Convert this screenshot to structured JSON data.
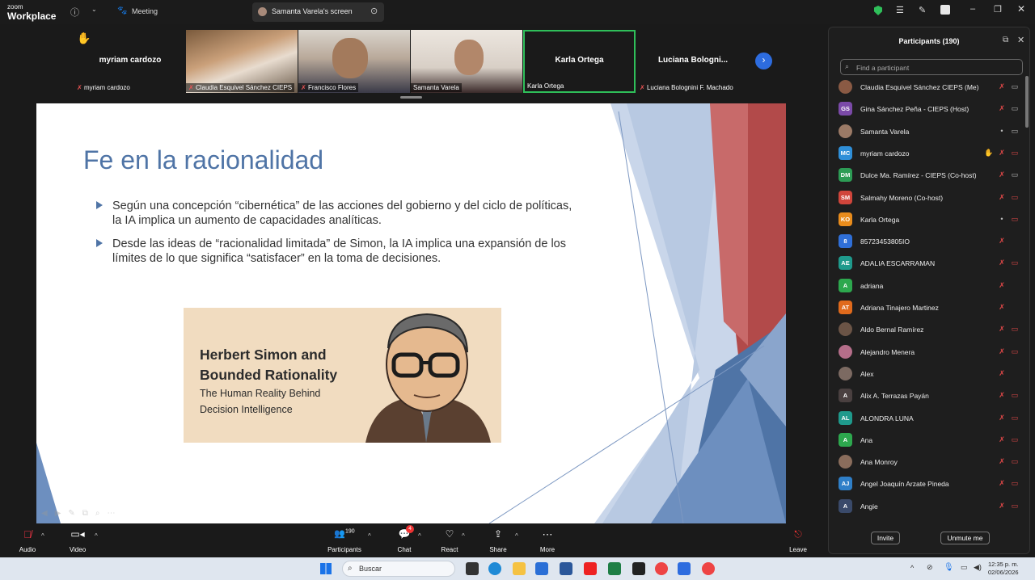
{
  "app": {
    "brand_small": "zoom",
    "brand_big": "Workplace",
    "meeting_label": "Meeting",
    "screen_tab": "Samanta Varela's screen"
  },
  "strip": {
    "tiles": [
      {
        "big_name": "myriam cardozo",
        "label": "myriam cardozo"
      },
      {
        "label": "Claudia Esquivel Sánchez CIEPS"
      },
      {
        "label": "Francisco Flores"
      },
      {
        "label": "Samanta Varela"
      },
      {
        "big_name": "Karla Ortega",
        "label": "Karla Ortega"
      },
      {
        "big_name": "Luciana  Bologni...",
        "label": "Luciana Bolognini F. Machado"
      }
    ]
  },
  "slide": {
    "title": "Fe en la racionalidad",
    "bullets": [
      "Según una concepción “cibernética” de las acciones del gobierno y del ciclo de políticas, la IA implica un aumento de capacidades analíticas.",
      "Desde las ideas de “racionalidad limitada” de Simon, la IA implica una expansión de los límites de lo que significa “satisfacer” en la toma de decisiones."
    ],
    "card": {
      "line1": "Herbert Simon and",
      "line2": "Bounded Rationality",
      "sub1": "The Human Reality Behind",
      "sub2": "Decision Intelligence"
    }
  },
  "participants": {
    "title": "Participants (190)",
    "search_placeholder": "Find a participant",
    "list": [
      {
        "initials": "",
        "name": "Claudia Esquivel Sánchez CIEPS (Me)",
        "color": "#8a5a44"
      },
      {
        "initials": "GS",
        "name": "Gina Sánchez Peña - CIEPS (Host)",
        "color": "#7b4aa8"
      },
      {
        "initials": "",
        "name": "Samanta Varela",
        "color": "#9b7a66"
      },
      {
        "initials": "MC",
        "name": "myriam cardozo",
        "color": "#2f8fd8"
      },
      {
        "initials": "DM",
        "name": "Dulce Ma. Ramírez - CIEPS (Co-host)",
        "color": "#2d9c55"
      },
      {
        "initials": "SM",
        "name": "Salmahy Moreno (Co-host)",
        "color": "#d0453b"
      },
      {
        "initials": "KO",
        "name": "Karla Ortega",
        "color": "#e98c1c"
      },
      {
        "initials": "8",
        "name": "85723453805IO",
        "color": "#2f6fd8"
      },
      {
        "initials": "AE",
        "name": "ADALIA ESCARRAMAN",
        "color": "#1f9a8c"
      },
      {
        "initials": "A",
        "name": "adriana",
        "color": "#2da84e"
      },
      {
        "initials": "AT",
        "name": "Adriana Tinajero Martinez",
        "color": "#e06a1c"
      },
      {
        "initials": "",
        "name": "Aldo Bernal Ramírez",
        "color": "#6b5446"
      },
      {
        "initials": "",
        "name": "Alejandro Menera",
        "color": "#b56e8a"
      },
      {
        "initials": "",
        "name": "Alex",
        "color": "#7c6a62"
      },
      {
        "initials": "A",
        "name": "Alix A. Terrazas Payán",
        "color": "#4a4040"
      },
      {
        "initials": "AL",
        "name": "ALONDRA LUNA",
        "color": "#1f9a8c"
      },
      {
        "initials": "A",
        "name": "Ana",
        "color": "#2da84e"
      },
      {
        "initials": "",
        "name": "Ana Monroy",
        "color": "#8a6d5c"
      },
      {
        "initials": "AJ",
        "name": "Angel Joaquín Arzate Pineda",
        "color": "#2f7fc8"
      },
      {
        "initials": "A",
        "name": "Angie",
        "color": "#3a4a6a"
      }
    ],
    "invite": "Invite",
    "unmute_me": "Unmute me"
  },
  "toolbar": {
    "audio": "Audio",
    "video": "Video",
    "participants": "Participants",
    "participants_count": "190",
    "chat": "Chat",
    "chat_badge": "4",
    "react": "React",
    "share": "Share",
    "more": "More",
    "leave": "Leave"
  },
  "taskbar": {
    "search": "Buscar",
    "time": "12:35 p. m.",
    "date": "02/06/2026"
  }
}
